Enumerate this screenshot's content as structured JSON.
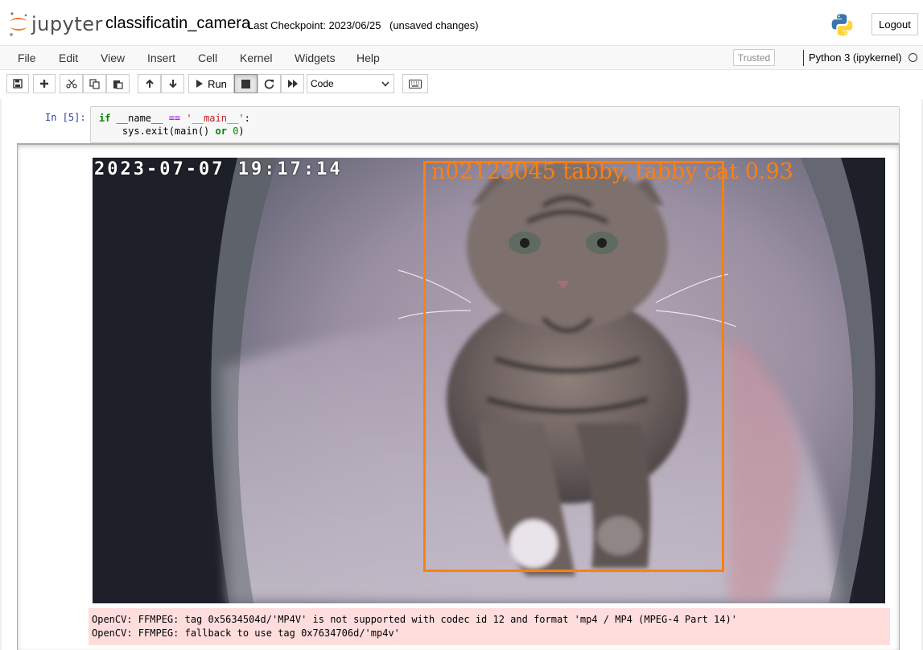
{
  "header": {
    "logo_text": "jupyter",
    "notebook_name": "classificatin_camera",
    "checkpoint": "Last Checkpoint: 2023/06/25",
    "autosave": "(unsaved changes)",
    "logout_label": "Logout"
  },
  "menubar": {
    "items": [
      "File",
      "Edit",
      "View",
      "Insert",
      "Cell",
      "Kernel",
      "Widgets",
      "Help"
    ],
    "trusted": "Trusted",
    "kernel": "Python 3 (ipykernel)"
  },
  "toolbar": {
    "run_label": "Run",
    "cell_type": "Code",
    "icons": [
      "save-icon",
      "plus-icon",
      "cut-icon",
      "copy-icon",
      "paste-icon",
      "arrow-up-icon",
      "arrow-down-icon",
      "play-icon",
      "stop-icon",
      "restart-icon",
      "fast-forward-icon",
      "keyboard-icon"
    ]
  },
  "cell": {
    "prompt": "In [5]:",
    "code_line1": {
      "kw": "if",
      "a": " __name__ ",
      "op": "==",
      "b": " ",
      "str": "'__main__'",
      "c": ":"
    },
    "code_line2": {
      "a": "    sys.exit(main() ",
      "kw": "or",
      "b": " ",
      "num": "0",
      "c": ")"
    }
  },
  "output": {
    "timestamp": "2023-07-07 19:17:14",
    "detection_label": "n02123045 tabby, tabby cat 0.93",
    "stderr_line1": "OpenCV: FFMPEG: tag 0x5634504d/'MP4V' is not supported with codec id 12 and format 'mp4 / MP4 (MPEG-4 Part 14)'",
    "stderr_line2": "OpenCV: FFMPEG: fallback to use tag 0x7634706d/'mp4v'"
  },
  "colors": {
    "accent_orange": "#ff7f0e",
    "jupyter_orange": "#f37726",
    "stderr_bg": "#ffdddd"
  }
}
